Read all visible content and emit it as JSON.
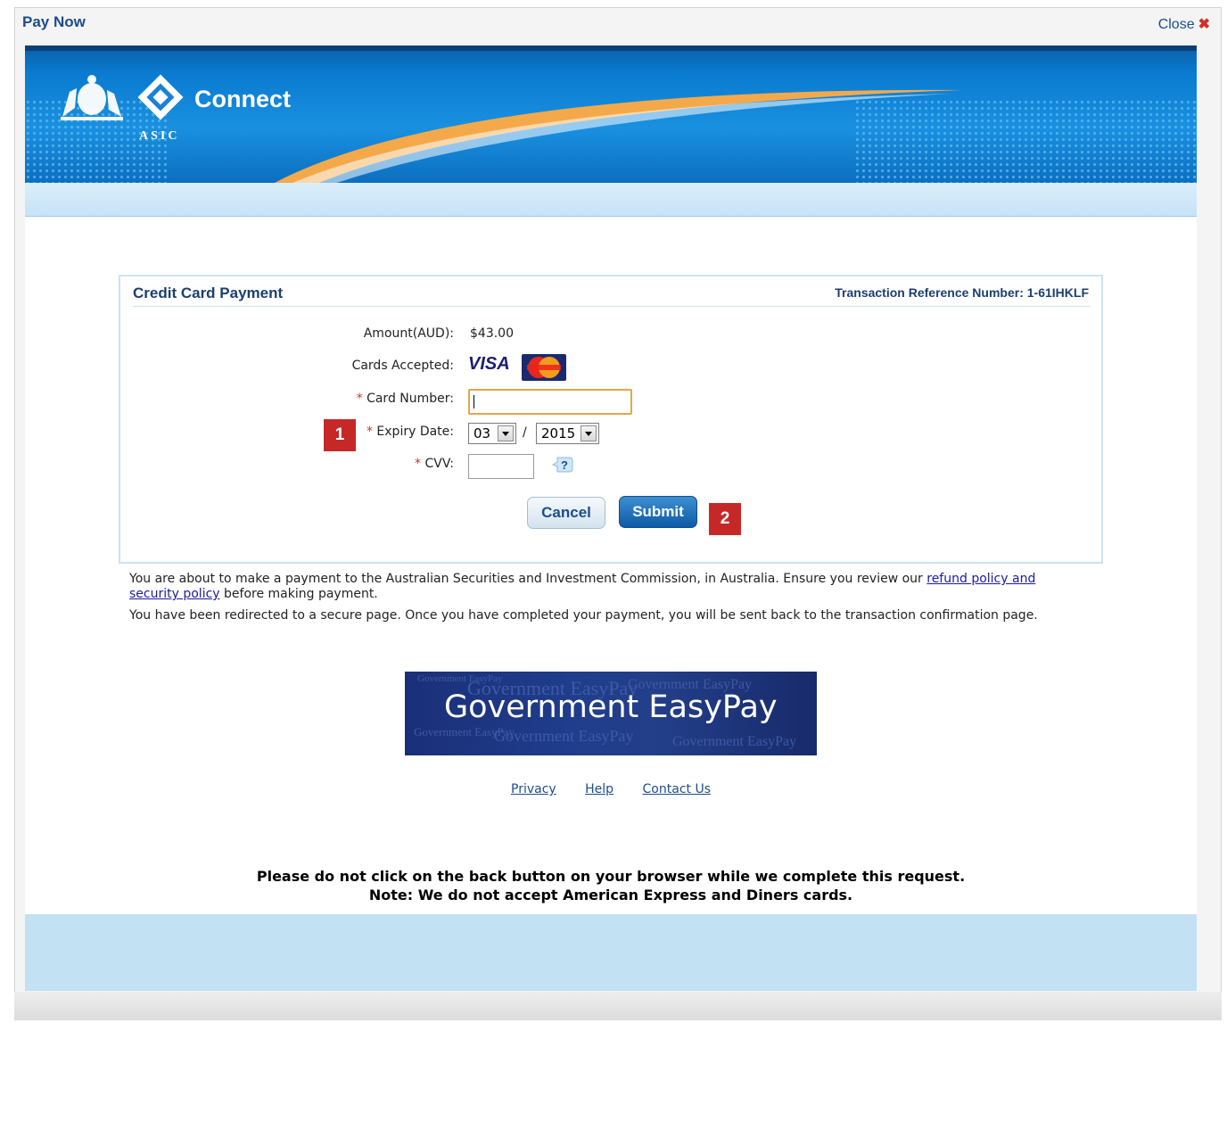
{
  "dialog": {
    "title": "Pay Now",
    "close_label": "Close"
  },
  "header": {
    "brand": "Connect",
    "org": "ASIC"
  },
  "payment": {
    "title": "Credit Card Payment",
    "reference": "Transaction Reference Number: 1-61IHKLF",
    "amount_label": "Amount(AUD):",
    "amount_value": "$43.00",
    "cards_label": "Cards Accepted:",
    "visa": "VISA",
    "card_number_label": "Card Number:",
    "card_number_value": "",
    "expiry_label": "Expiry Date:",
    "expiry_month": "03",
    "expiry_separator": "/",
    "expiry_year": "2015",
    "cvv_label": "CVV:",
    "cvv_value": "",
    "required_mark": "*",
    "cancel_label": "Cancel",
    "submit_label": "Submit"
  },
  "badges": {
    "b1": "1",
    "b2": "2"
  },
  "info": {
    "p1_before": "You are about to make a payment to the Australian Securities and Investment Commission, in Australia. Ensure you review our ",
    "p1_link": "refund policy and security policy",
    "p1_after": " before making payment.",
    "p2": "You have been redirected to a secure page. Once you have completed your payment, you will be sent back to the transaction confirmation page."
  },
  "easypay": {
    "label": "Government EasyPay"
  },
  "footer": {
    "privacy": "Privacy",
    "help": "Help",
    "contact": "Contact Us"
  },
  "warning": {
    "line1": "Please do not click on the back button on your browser while we complete this request.",
    "line2": "Note: We do not accept American Express and Diners cards."
  }
}
